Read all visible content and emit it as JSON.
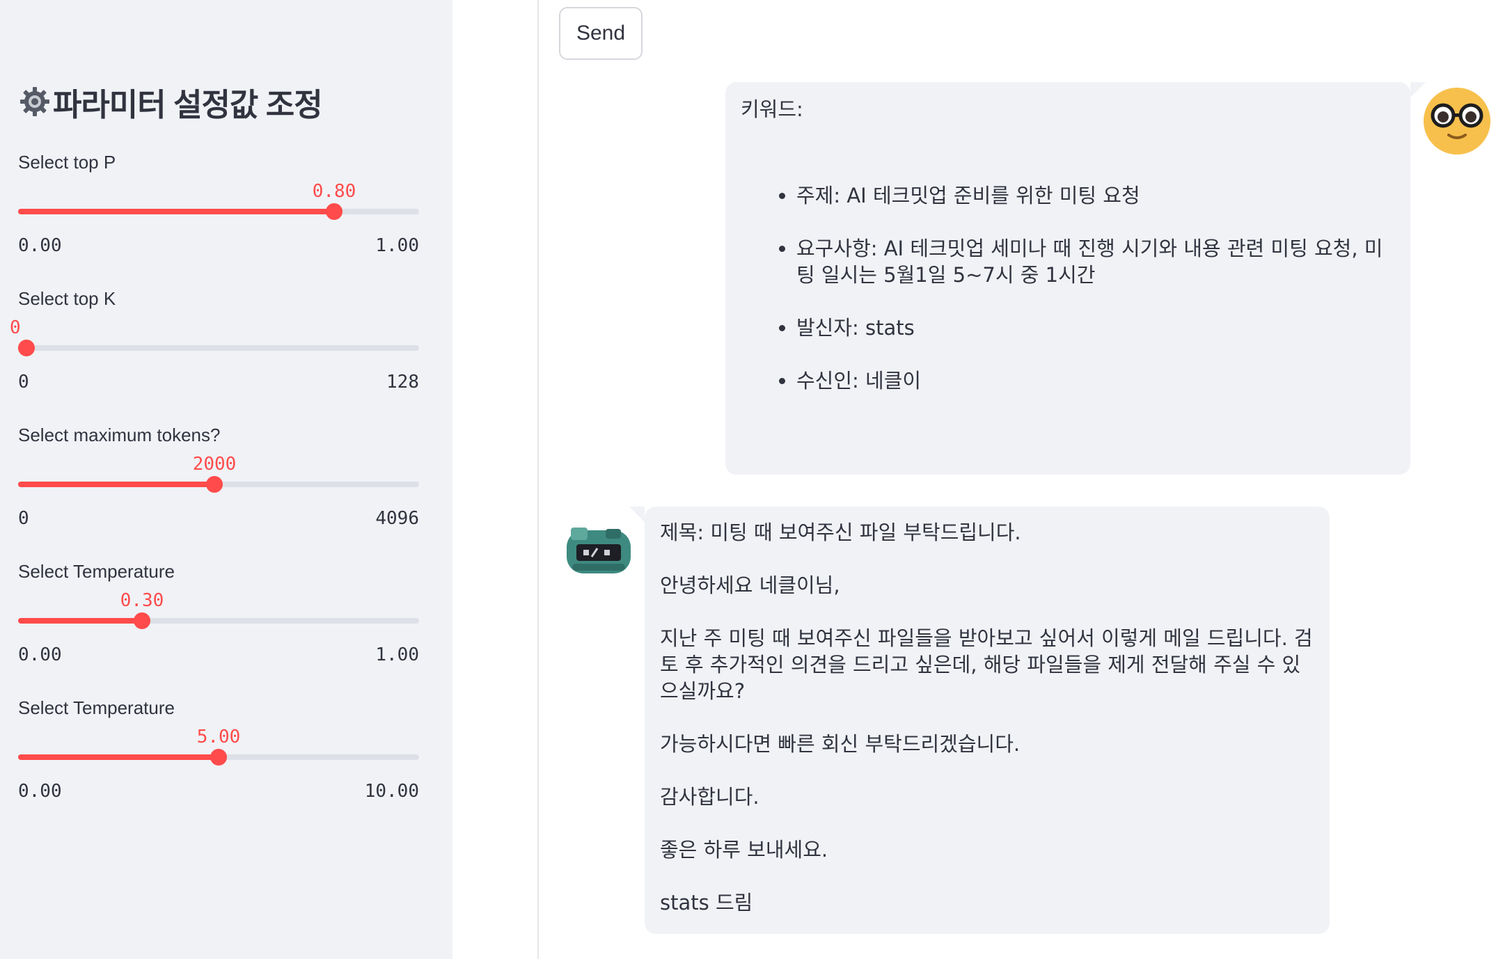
{
  "sidebar": {
    "title": "파라미터 설정값 조정",
    "title_icon": "gear-icon",
    "sliders": [
      {
        "label": "Select top P",
        "value": "0.80",
        "min": "0.00",
        "max": "1.00",
        "fraction": 0.8
      },
      {
        "label": "Select top K",
        "value": "0",
        "min": "0",
        "max": "128",
        "fraction": 0.0
      },
      {
        "label": "Select maximum tokens?",
        "value": "2000",
        "min": "0",
        "max": "4096",
        "fraction": 0.4883
      },
      {
        "label": "Select Temperature",
        "value": "0.30",
        "min": "0.00",
        "max": "1.00",
        "fraction": 0.3
      },
      {
        "label": "Select Temperature",
        "value": "5.00",
        "min": "0.00",
        "max": "10.00",
        "fraction": 0.5
      }
    ]
  },
  "main": {
    "send_label": "Send",
    "user_message": {
      "title": "키워드:",
      "items": [
        "주제: AI 테크밋업 준비를 위한 미팅 요청",
        "요구사항: AI 테크밋업 세미나 때 진행 시기와 내용 관련 미팅 요청, 미팅 일시는 5월1일 5~7시 중 1시간",
        "발신자: stats",
        "수신인: 네클이"
      ]
    },
    "bot_message": {
      "paragraphs": [
        "제목: 미팅 때 보여주신 파일 부탁드립니다.",
        "안녕하세요 네클이님,",
        "지난 주 미팅 때 보여주신 파일들을 받아보고 싶어서 이렇게 메일 드립니다. 검토 후 추가적인 의견을 드리고 싶은데, 해당 파일들을 제게 전달해 주실 수 있으실까요?",
        "가능하시다면 빠른 회신 부탁드리겠습니다.",
        "감사합니다.",
        "좋은 하루 보내세요.",
        "stats 드림"
      ]
    },
    "user_avatar": "nerd-face-icon",
    "bot_avatar": "robot-avatar-icon"
  },
  "colors": {
    "accent": "#ff4b4b",
    "sidebar_bg": "#f0f2f6",
    "bubble_bg": "#f0f2f6",
    "track": "#dde0e6",
    "avatar_user": "#f7c04c"
  }
}
